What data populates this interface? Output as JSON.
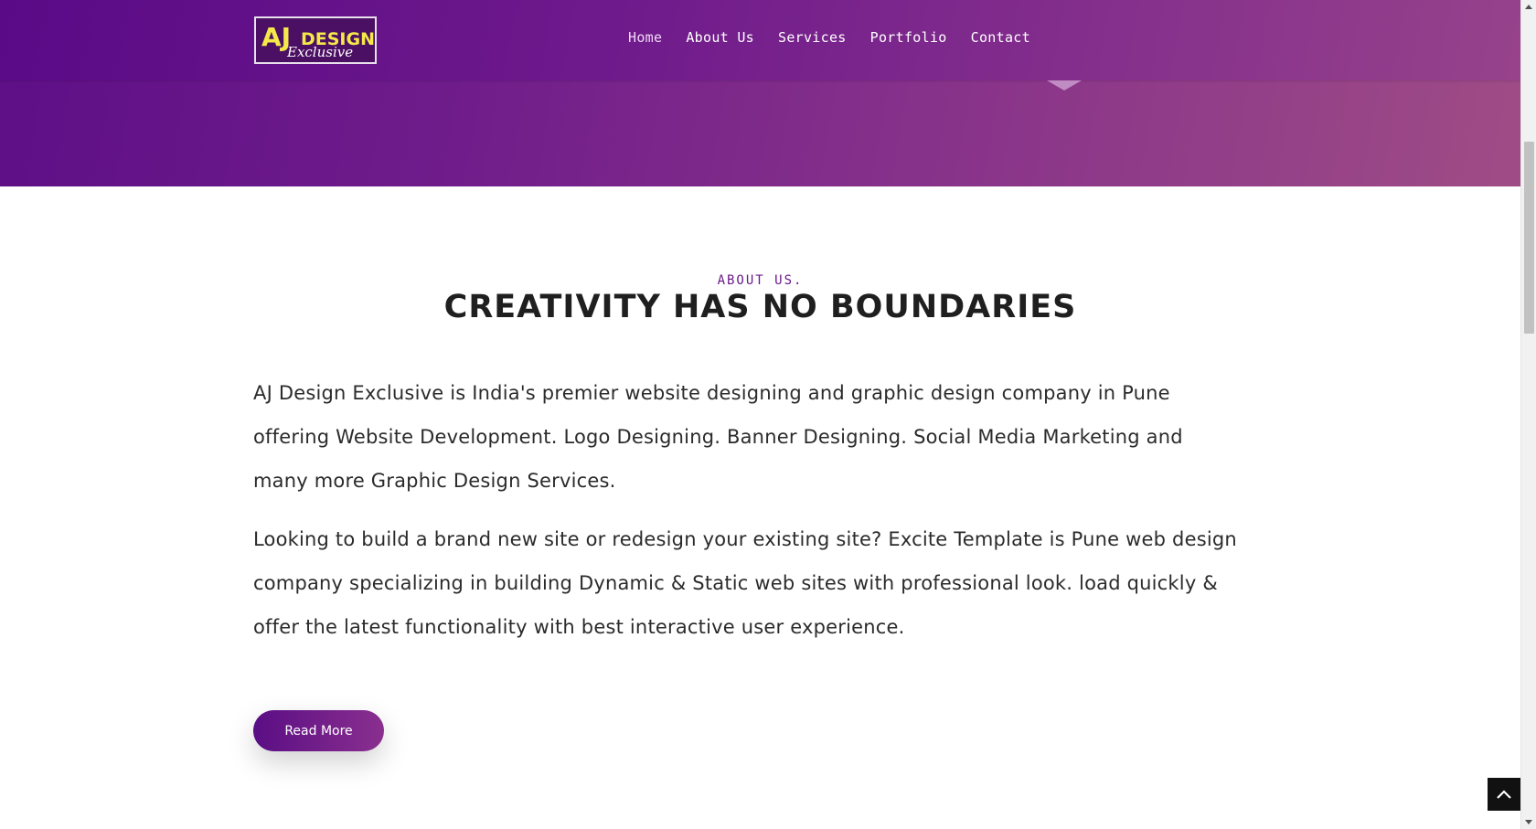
{
  "brand": {
    "logo_text_main": "AJ DESIGN",
    "logo_text_script": "Exclusive",
    "logo_alt": "AJ Design Exclusive logo"
  },
  "nav": {
    "items": [
      {
        "label": "Home",
        "active": true
      },
      {
        "label": "About Us",
        "active": false
      },
      {
        "label": "Services",
        "active": false
      },
      {
        "label": "Portfolio",
        "active": false
      },
      {
        "label": "Contact",
        "active": false
      }
    ]
  },
  "about": {
    "eyebrow": "ABOUT US.",
    "title": "CREATIVITY HAS NO BOUNDARIES",
    "paragraph1": "AJ Design Exclusive is India's premier website designing and graphic design company in Pune offering Website Development. Logo Designing. Banner Designing. Social Media Marketing and many more Graphic Design Services.",
    "paragraph2": "Looking to build a brand new site or redesign your existing site? Excite Template is Pune web design company specializing in building Dynamic & Static web sites with professional look. load quickly & offer the latest functionality with best interactive user experience.",
    "read_more_label": "Read More"
  },
  "colors": {
    "brand_purple": "#5e0f86",
    "brand_pink": "#9f4c86",
    "logo_yellow": "#f5e94a",
    "eyebrow": "#6a1a8a"
  },
  "icons": {
    "back_to_top": "chevron-up-icon"
  }
}
